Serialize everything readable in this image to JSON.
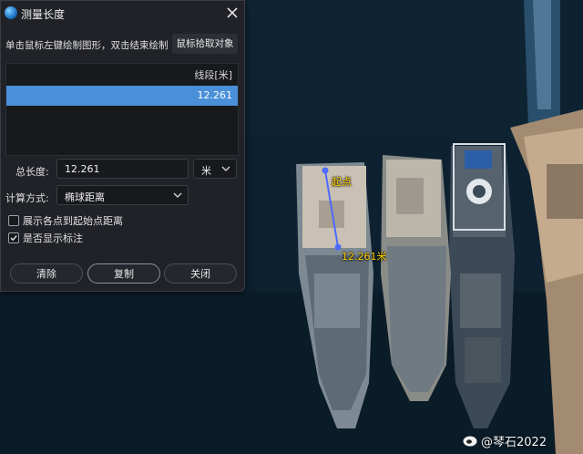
{
  "dialog": {
    "title": "测量长度",
    "hint": "单击鼠标左键绘制图形，双击结束绘制",
    "pick_button": "鼠标拾取对象",
    "table": {
      "header": "线段[米]",
      "rows": [
        "12.261"
      ]
    },
    "total_length_label": "总长度:",
    "total_length_value": "12.261",
    "unit_value": "米",
    "calc_label": "计算方式:",
    "calc_value": "椭球距离",
    "option_show_distance": {
      "label": "展示各点到起始点距离",
      "checked": false
    },
    "option_show_label": {
      "label": "是否显示标注",
      "checked": true
    },
    "buttons": {
      "clear": "清除",
      "copy": "复制",
      "close": "关闭"
    }
  },
  "map": {
    "start_label": "起点",
    "end_label": "12.261米",
    "line_color": "#4d6bff",
    "label_color": "#ffd200"
  },
  "watermark": "@琴石2022",
  "colors": {
    "accent": "#4a90d9",
    "dialog_bg": "#202227"
  }
}
